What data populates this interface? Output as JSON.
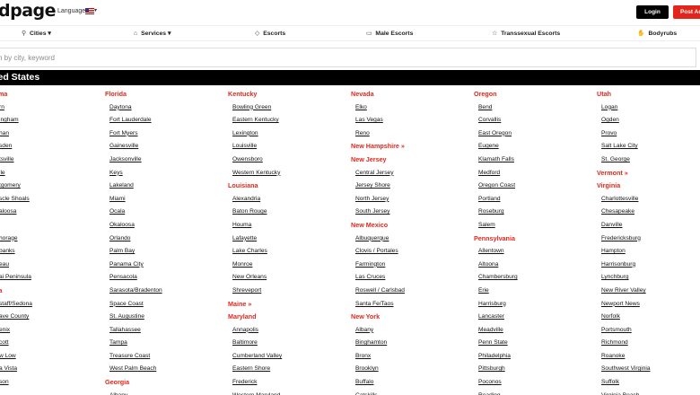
{
  "header": {
    "logo": "dpage",
    "language_label": "Language",
    "login": "Login",
    "post_ad": "Post Ad"
  },
  "nav": {
    "cities": "Cities",
    "services": "Services",
    "escorts": "Escorts",
    "male_escorts": "Male Escorts",
    "trans_escorts": "Transsexual Escorts",
    "bodyrubs": "Bodyrubs"
  },
  "search": {
    "placeholder": "h by city, keyword"
  },
  "region": "ted States",
  "columns": [
    [
      {
        "type": "state",
        "label": "ama"
      },
      {
        "type": "city",
        "label": "rn"
      },
      {
        "type": "city",
        "label": "ingham"
      },
      {
        "type": "city",
        "label": "han"
      },
      {
        "type": "city",
        "label": "sden"
      },
      {
        "type": "city",
        "label": "tsville"
      },
      {
        "type": "city",
        "label": "ile"
      },
      {
        "type": "city",
        "label": "tgomery"
      },
      {
        "type": "city",
        "label": "scle Shoals"
      },
      {
        "type": "city",
        "label": "aloosa"
      },
      {
        "type": "state",
        "label": "a"
      },
      {
        "type": "city",
        "label": "horage"
      },
      {
        "type": "city",
        "label": "banks"
      },
      {
        "type": "city",
        "label": "eau"
      },
      {
        "type": "city",
        "label": "ai Peninsula"
      },
      {
        "type": "state",
        "label": "na"
      },
      {
        "type": "city",
        "label": "staff/Sedona"
      },
      {
        "type": "city",
        "label": "ave County"
      },
      {
        "type": "city",
        "label": "enix"
      },
      {
        "type": "city",
        "label": "cott"
      },
      {
        "type": "city",
        "label": "w Low"
      },
      {
        "type": "city",
        "label": "a Vista"
      },
      {
        "type": "city",
        "label": "son"
      }
    ],
    [
      {
        "type": "state",
        "label": "Florida"
      },
      {
        "type": "city",
        "label": "Daytona"
      },
      {
        "type": "city",
        "label": "Fort Lauderdale"
      },
      {
        "type": "city",
        "label": "Fort Myers"
      },
      {
        "type": "city",
        "label": "Gainesville"
      },
      {
        "type": "city",
        "label": "Jacksonville"
      },
      {
        "type": "city",
        "label": "Keys"
      },
      {
        "type": "city",
        "label": "Lakeland"
      },
      {
        "type": "city",
        "label": "Miami"
      },
      {
        "type": "city",
        "label": "Ocala"
      },
      {
        "type": "city",
        "label": "Okaloosa"
      },
      {
        "type": "city",
        "label": "Orlando"
      },
      {
        "type": "city",
        "label": "Palm Bay"
      },
      {
        "type": "city",
        "label": "Panama City"
      },
      {
        "type": "city",
        "label": "Pensacola"
      },
      {
        "type": "city",
        "label": "Sarasota/Bradenton"
      },
      {
        "type": "city",
        "label": "Space Coast"
      },
      {
        "type": "city",
        "label": "St. Augustine"
      },
      {
        "type": "city",
        "label": "Tallahassee"
      },
      {
        "type": "city",
        "label": "Tampa"
      },
      {
        "type": "city",
        "label": "Treasure Coast"
      },
      {
        "type": "city",
        "label": "West Palm Beach"
      },
      {
        "type": "state",
        "label": "Georgia"
      },
      {
        "type": "city",
        "label": "Albany"
      }
    ],
    [
      {
        "type": "state",
        "label": "Kentucky"
      },
      {
        "type": "city",
        "label": "Bowling Green"
      },
      {
        "type": "city",
        "label": "Eastern Kentucky"
      },
      {
        "type": "city",
        "label": "Lexington"
      },
      {
        "type": "city",
        "label": "Louisville"
      },
      {
        "type": "city",
        "label": "Owensboro"
      },
      {
        "type": "city",
        "label": "Western Kentucky"
      },
      {
        "type": "state",
        "label": "Louisiana"
      },
      {
        "type": "city",
        "label": "Alexandria"
      },
      {
        "type": "city",
        "label": "Baton Rouge"
      },
      {
        "type": "city",
        "label": "Houma"
      },
      {
        "type": "city",
        "label": "Lafayette"
      },
      {
        "type": "city",
        "label": "Lake Charles"
      },
      {
        "type": "city",
        "label": "Monroe"
      },
      {
        "type": "city",
        "label": "New Orleans"
      },
      {
        "type": "city",
        "label": "Shreveport"
      },
      {
        "type": "state",
        "label": "Maine »"
      },
      {
        "type": "state",
        "label": "Maryland"
      },
      {
        "type": "city",
        "label": "Annapolis"
      },
      {
        "type": "city",
        "label": "Baltimore"
      },
      {
        "type": "city",
        "label": "Cumberland Valley"
      },
      {
        "type": "city",
        "label": "Eastern Shore"
      },
      {
        "type": "city",
        "label": "Frederick"
      },
      {
        "type": "city",
        "label": "Western Maryland"
      }
    ],
    [
      {
        "type": "state",
        "label": "Nevada"
      },
      {
        "type": "city",
        "label": "Elko"
      },
      {
        "type": "city",
        "label": "Las Vegas"
      },
      {
        "type": "city",
        "label": "Reno"
      },
      {
        "type": "state",
        "label": "New Hampshire »"
      },
      {
        "type": "state",
        "label": "New Jersey"
      },
      {
        "type": "city",
        "label": "Central Jersey"
      },
      {
        "type": "city",
        "label": "Jersey Shore"
      },
      {
        "type": "city",
        "label": "North Jersey"
      },
      {
        "type": "city",
        "label": "South Jersey"
      },
      {
        "type": "state",
        "label": "New Mexico"
      },
      {
        "type": "city",
        "label": "Albuquerque"
      },
      {
        "type": "city",
        "label": "Clovis / Portales"
      },
      {
        "type": "city",
        "label": "Farmington"
      },
      {
        "type": "city",
        "label": "Las Cruces"
      },
      {
        "type": "city",
        "label": "Roswell / Carlsbad"
      },
      {
        "type": "city",
        "label": "Santa Fe/Taos"
      },
      {
        "type": "state",
        "label": "New York"
      },
      {
        "type": "city",
        "label": "Albany"
      },
      {
        "type": "city",
        "label": "Binghamton"
      },
      {
        "type": "city",
        "label": "Bronx"
      },
      {
        "type": "city",
        "label": "Brooklyn"
      },
      {
        "type": "city",
        "label": "Buffalo"
      },
      {
        "type": "city",
        "label": "Catskills"
      }
    ],
    [
      {
        "type": "state",
        "label": "Oregon"
      },
      {
        "type": "city",
        "label": "Bend"
      },
      {
        "type": "city",
        "label": "Corvallis"
      },
      {
        "type": "city",
        "label": "East Oregon"
      },
      {
        "type": "city",
        "label": "Eugene"
      },
      {
        "type": "city",
        "label": "Klamath Falls"
      },
      {
        "type": "city",
        "label": "Medford"
      },
      {
        "type": "city",
        "label": "Oregon Coast"
      },
      {
        "type": "city",
        "label": "Portland"
      },
      {
        "type": "city",
        "label": "Roseburg"
      },
      {
        "type": "city",
        "label": "Salem"
      },
      {
        "type": "state",
        "label": "Pennsylvania"
      },
      {
        "type": "city",
        "label": "Allentown"
      },
      {
        "type": "city",
        "label": "Altoona"
      },
      {
        "type": "city",
        "label": "Chambersburg"
      },
      {
        "type": "city",
        "label": "Erie"
      },
      {
        "type": "city",
        "label": "Harrisburg"
      },
      {
        "type": "city",
        "label": "Lancaster"
      },
      {
        "type": "city",
        "label": "Meadville"
      },
      {
        "type": "city",
        "label": "Penn State"
      },
      {
        "type": "city",
        "label": "Philadelphia"
      },
      {
        "type": "city",
        "label": "Pittsburgh"
      },
      {
        "type": "city",
        "label": "Poconos"
      },
      {
        "type": "city",
        "label": "Reading"
      }
    ],
    [
      {
        "type": "state",
        "label": "Utah"
      },
      {
        "type": "city",
        "label": "Logan"
      },
      {
        "type": "city",
        "label": "Ogden"
      },
      {
        "type": "city",
        "label": "Provo"
      },
      {
        "type": "city",
        "label": "Salt Lake City"
      },
      {
        "type": "city",
        "label": "St. George"
      },
      {
        "type": "state",
        "label": "Vermont »"
      },
      {
        "type": "state",
        "label": "Virginia"
      },
      {
        "type": "city",
        "label": "Charlottesville"
      },
      {
        "type": "city",
        "label": "Chesapeake"
      },
      {
        "type": "city",
        "label": "Danville"
      },
      {
        "type": "city",
        "label": "Fredericksburg"
      },
      {
        "type": "city",
        "label": "Hampton"
      },
      {
        "type": "city",
        "label": "Harrisonburg"
      },
      {
        "type": "city",
        "label": "Lynchburg"
      },
      {
        "type": "city",
        "label": "New River Valley"
      },
      {
        "type": "city",
        "label": "Newport News"
      },
      {
        "type": "city",
        "label": "Norfolk"
      },
      {
        "type": "city",
        "label": "Portsmouth"
      },
      {
        "type": "city",
        "label": "Richmond"
      },
      {
        "type": "city",
        "label": "Roanoke"
      },
      {
        "type": "city",
        "label": "Southwest Virginia"
      },
      {
        "type": "city",
        "label": "Suffolk"
      },
      {
        "type": "city",
        "label": "Virginia Beach"
      }
    ]
  ]
}
